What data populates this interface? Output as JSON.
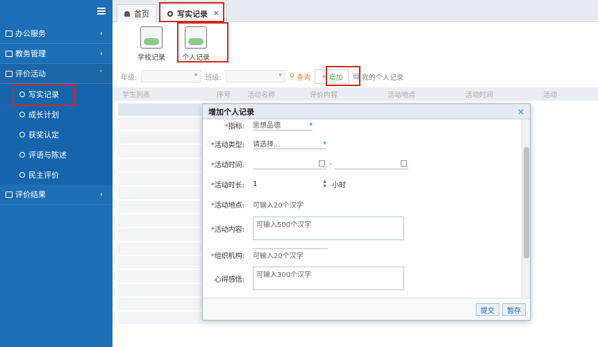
{
  "sidebar": {
    "menu": [
      {
        "label": "办公服务",
        "chevron": "‹"
      },
      {
        "label": "教务管理",
        "chevron": "‹"
      },
      {
        "label": "评价活动",
        "chevron": "ˇ"
      }
    ],
    "sub_items": [
      {
        "label": "写实记录"
      },
      {
        "label": "成长计划"
      },
      {
        "label": "获奖认定"
      },
      {
        "label": "评语与陈述"
      },
      {
        "label": "民主评价"
      }
    ],
    "bottom_menu": {
      "label": "评价结果",
      "chevron": "‹"
    }
  },
  "tabs": [
    {
      "label": "首页"
    },
    {
      "label": "写实记录",
      "close": "×"
    }
  ],
  "toolbar": {
    "school_record": "学校记录",
    "personal_record": "个人记录"
  },
  "filters": {
    "grade_label": "年级:",
    "class_label": "班级:",
    "query": "查询",
    "add": "增加",
    "my_record": "我的个人记录"
  },
  "grid": {
    "left_header": "学生列表",
    "columns": [
      "序号",
      "活动名称",
      "评价内容",
      "活动地点",
      "活动时间",
      "活动"
    ]
  },
  "modal": {
    "title": "增加个人记录",
    "close": "×",
    "fields": {
      "indicator_label": "指标:",
      "indicator_value": "思想品德",
      "type_label": "活动类型:",
      "type_value": "请选择...",
      "time_label": "活动时间:",
      "time_sep": "-",
      "duration_label": "活动时长:",
      "duration_value": "1",
      "duration_unit": "小时",
      "location_label": "活动地点:",
      "location_placeholder": "可输入20个汉字",
      "content_label": "活动内容:",
      "content_placeholder": "可输入500个汉字",
      "org_label": "组织机构:",
      "org_placeholder": "可输入20个汉字",
      "reflection_label": "心得感悟:",
      "reflection_placeholder": "可输入300个汉字"
    },
    "submit": "提交",
    "save": "暂存"
  },
  "colors": {
    "sidebar_bg": "#1c6fb5",
    "highlight_red": "#d9231c",
    "add_green": "#55a85e",
    "query_orange": "#e28b2d"
  }
}
